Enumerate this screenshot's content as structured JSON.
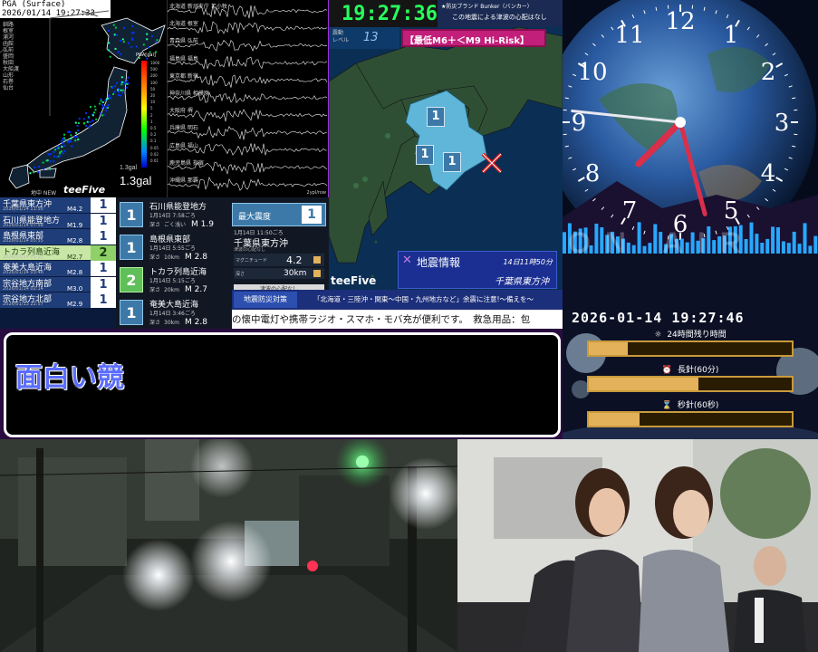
{
  "pga": {
    "header": "PGA (Surface)",
    "datetime": "2026/01/14 19:27:33",
    "station_list": [
      "釧路",
      "根室",
      "浦河",
      "函館",
      "弘前",
      "盛岡",
      "秋田",
      "大船渡",
      "山形",
      "石巻",
      "仙台"
    ],
    "scale_title": "PGA[gal]",
    "scale_ticks": [
      "1000",
      "500",
      "200",
      "100",
      "50",
      "20",
      "10",
      "5",
      "2",
      "1",
      "0.5",
      "0.2",
      "0.1",
      "0.05",
      "0.02",
      "0.01"
    ],
    "gal_small": "1.3gal",
    "gal_large": "1.3gal",
    "footer_left": "地中 NEW",
    "logo": "teeFive"
  },
  "waves": {
    "stations": [
      "北海道 新冠支庁 苫小牧",
      "北海道 根室",
      "青森県 弘前",
      "福島県 福島",
      "東京都 新宿",
      "神奈川県 相模原",
      "大阪府 堺",
      "兵庫県 明石",
      "広島県 福山",
      "鹿児島県 指宿",
      "沖縄県 那覇"
    ],
    "footer_right": "2ypl/row"
  },
  "reports": [
    {
      "name": "千葉県東方沖",
      "time": "2026/01/14 11:50",
      "mag": "M4.2",
      "shindo": "1",
      "highlight": false
    },
    {
      "name": "石川県能登地方",
      "time": "2026/01/14 07:58",
      "mag": "M1.9",
      "shindo": "1",
      "highlight": false
    },
    {
      "name": "島根県東部",
      "time": "2026/01/14 05:55",
      "mag": "M2.8",
      "shindo": "1",
      "highlight": false
    },
    {
      "name": "トカラ列島近海",
      "time": "2026/01/14 05:15",
      "mag": "M2.7",
      "shindo": "2",
      "highlight": true
    },
    {
      "name": "奄美大島近海",
      "time": "2026/01/14 03:46",
      "mag": "M2.8",
      "shindo": "1",
      "highlight": false
    },
    {
      "name": "宗谷地方南部",
      "time": "2026/01/14 02:14",
      "mag": "M3.0",
      "shindo": "1",
      "highlight": false
    },
    {
      "name": "宗谷地方北部",
      "time": "2026/01/13 22:57",
      "mag": "M2.9",
      "shindo": "1",
      "highlight": false
    }
  ],
  "detail_cards": [
    {
      "shindo": "1",
      "name": "石川県能登地方",
      "time": "1月14日 7:58ごろ",
      "depth_label": "深さ",
      "depth": "ごく浅い",
      "mag": "M 1.9"
    },
    {
      "shindo": "1",
      "name": "島根県東部",
      "time": "1月14日 5:55ごろ",
      "depth_label": "深さ",
      "depth": "10km",
      "mag": "M 2.8"
    },
    {
      "shindo": "2",
      "name": "トカラ列島近海",
      "time": "1月14日 5:15ごろ",
      "depth_label": "深さ",
      "depth": "20km",
      "mag": "M 2.7"
    },
    {
      "shindo": "1",
      "name": "奄美大島近海",
      "time": "1月14日 3:46ごろ",
      "depth_label": "深さ",
      "depth": "30km",
      "mag": "M 2.8"
    }
  ],
  "max_shindo": {
    "label": "最大震度",
    "value": "1"
  },
  "quake_summary": {
    "time": "1月14日 11:50ごろ",
    "region": "千葉県東方沖",
    "note": "津波の心配なし",
    "mag_label": "マグニチュード",
    "mag": "4.2",
    "depth_label": "深さ",
    "depth": "30km",
    "footer": "津波の心配なし"
  },
  "region_map": {
    "clock": "19:27:36",
    "level_label": "震動\nレベル",
    "level": "13",
    "risk": "【最低M6＋＜M9 Hi-Risk】",
    "bunker": "★防災ブランド Bunker（バンカー）",
    "tsunami_note": "この地震による津波の心配はなし",
    "info_title": "地震情報",
    "info_time": "14日11時50分",
    "info_region": "千葉県東方沖",
    "shindo_markers": [
      "1",
      "1",
      "1"
    ],
    "logo": "teeFive"
  },
  "ticker": {
    "label": "地震防災対策",
    "alert": "「北海道・三陸沖・関東〜中国・九州地方など」余震に注意!〜備えを〜",
    "scroll": "の懐中電灯や携帯ラジオ・スマホ・モバ充が便利です。　救急用品：包"
  },
  "clock": {
    "numerals": [
      "12",
      "1",
      "2",
      "3",
      "4",
      "5",
      "6",
      "7",
      "8",
      "9",
      "10",
      "11"
    ],
    "datetime": "2026-01-14 19:27:46",
    "hour_angle": 225,
    "minute_angle": 165,
    "second_angle": 276,
    "bar_text": "ON AIR"
  },
  "timer": {
    "rows": [
      {
        "icon": "☼",
        "label": "24時間残り時間",
        "fraction": 0.19
      },
      {
        "icon": "⏰",
        "label": "長針(60分)",
        "fraction": 0.54
      },
      {
        "icon": "⌛",
        "label": "秒針(60秒)",
        "fraction": 0.25
      }
    ],
    "colors": {
      "bar_fill": "#e2b15a",
      "bar_border": "#c99a3b"
    }
  },
  "chat": {
    "text": "面白い競"
  },
  "colors": {
    "frame": "#9a2fd8",
    "accent_blue": "#1f3d78",
    "highlight_green": "#c8e6a5",
    "map_land": "#2f4f35",
    "map_alert": "#5fb6d9"
  }
}
